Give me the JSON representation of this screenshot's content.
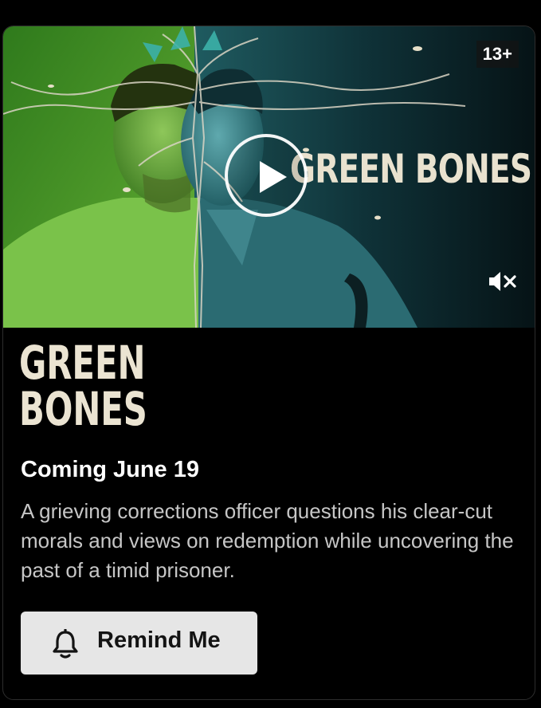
{
  "hero": {
    "rating": "13+",
    "title_art": "GREEN BONES",
    "play_icon": "play-circle-icon",
    "mute_icon": "volume-muted-icon"
  },
  "title_logo": {
    "line1": "GREEN",
    "line2": "BONES"
  },
  "coming": "Coming June 19",
  "description": "A grieving corrections officer questions his clear-cut morals and views on redemption while uncovering the past of a timid prisoner.",
  "remind": {
    "label": "Remind Me",
    "icon": "bell-icon"
  },
  "colors": {
    "background": "#000000",
    "button": "#e6e6e6",
    "title": "#ebe4d2",
    "green": "#5fa83a",
    "teal": "#2e7f86"
  }
}
